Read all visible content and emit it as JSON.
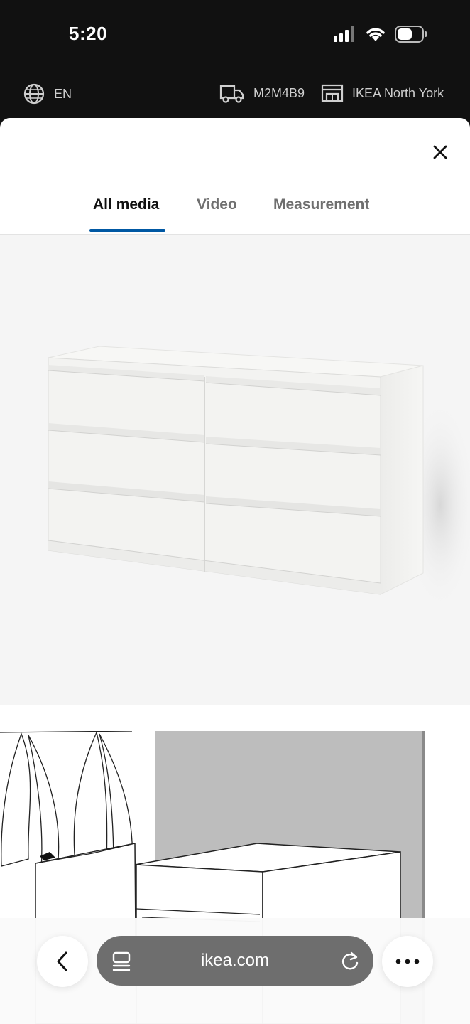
{
  "status_bar": {
    "time": "5:20"
  },
  "site_bar": {
    "language": "EN",
    "postal_code": "M2M4B9",
    "store": "IKEA North York",
    "icons": [
      "globe-icon",
      "delivery-truck-icon",
      "store-icon"
    ]
  },
  "modal": {
    "tabs": [
      {
        "label": "All media",
        "active": true
      },
      {
        "label": "Video",
        "active": false
      },
      {
        "label": "Measurement",
        "active": false
      }
    ],
    "accent_color": "#0058a3",
    "media": [
      {
        "kind": "image",
        "subject": "white six-drawer dresser"
      },
      {
        "kind": "image",
        "subject": "line drawing of dresser with open drawer"
      }
    ]
  },
  "browser": {
    "url": "ikea.com",
    "icons": [
      "back-chevron-icon",
      "tab-menu-icon",
      "reload-icon",
      "more-icon"
    ]
  }
}
